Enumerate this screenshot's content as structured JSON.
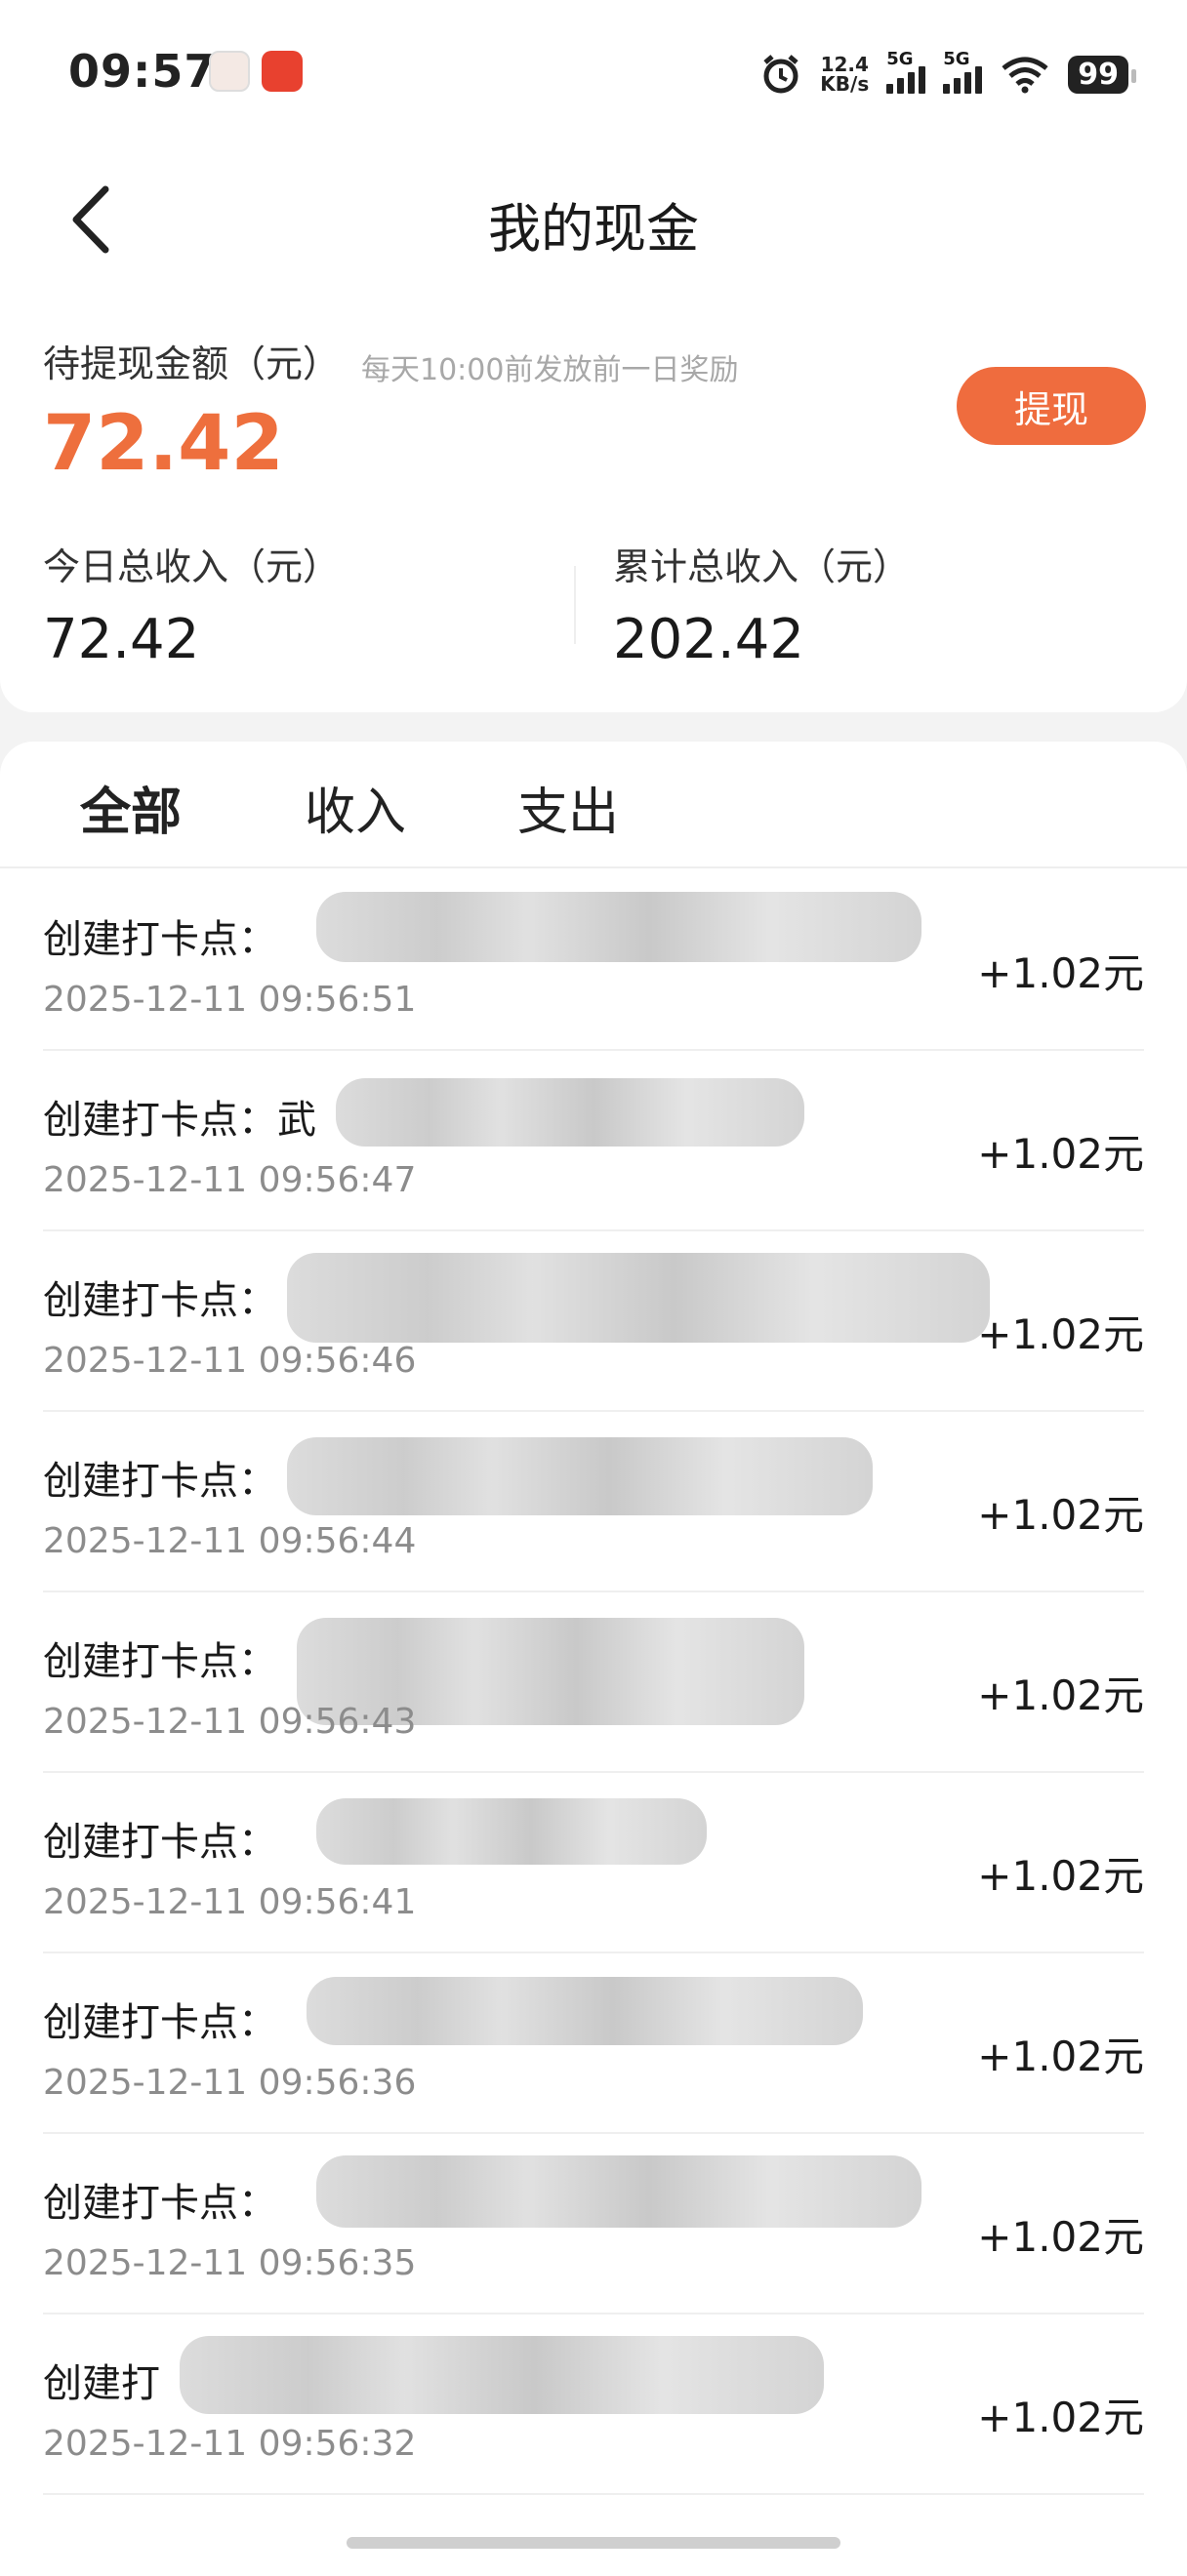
{
  "status": {
    "time": "09:57",
    "net_speed_value": "12.4",
    "net_speed_unit": "KB/s",
    "sim1": "5G",
    "sim2": "5G",
    "battery": "99"
  },
  "header": {
    "title": "我的现金"
  },
  "summary": {
    "pending_label": "待提现金额（元）",
    "pending_note": "每天10:00前发放前一日奖励",
    "pending_amount": "72.42",
    "withdraw_label": "提现",
    "today_label": "今日总收入（元）",
    "today_value": "72.42",
    "total_label": "累计总收入（元）",
    "total_value": "202.42"
  },
  "tabs": [
    "全部",
    "收入",
    "支出"
  ],
  "transactions": [
    {
      "name": "创建打卡点：",
      "date": "2025-12-11 09:56:51",
      "amount": "+1.02元"
    },
    {
      "name": "创建打卡点：武",
      "date": "2025-12-11 09:56:47",
      "amount": "+1.02元"
    },
    {
      "name": "创建打卡点：",
      "date": "2025-12-11 09:56:46",
      "amount": "+1.02元"
    },
    {
      "name": "创建打卡点：",
      "date": "2025-12-11 09:56:44",
      "amount": "+1.02元"
    },
    {
      "name": "创建打卡点：",
      "date": "2025-12-11 09:56:43",
      "amount": "+1.02元"
    },
    {
      "name": "创建打卡点：",
      "date": "2025-12-11 09:56:41",
      "amount": "+1.02元"
    },
    {
      "name": "创建打卡点：",
      "date": "2025-12-11 09:56:36",
      "amount": "+1.02元"
    },
    {
      "name": "创建打卡点：",
      "date": "2025-12-11 09:56:35",
      "amount": "+1.02元"
    },
    {
      "name": "创建打",
      "date": "2025-12-11 09:56:32",
      "amount": "+1.02元"
    }
  ]
}
